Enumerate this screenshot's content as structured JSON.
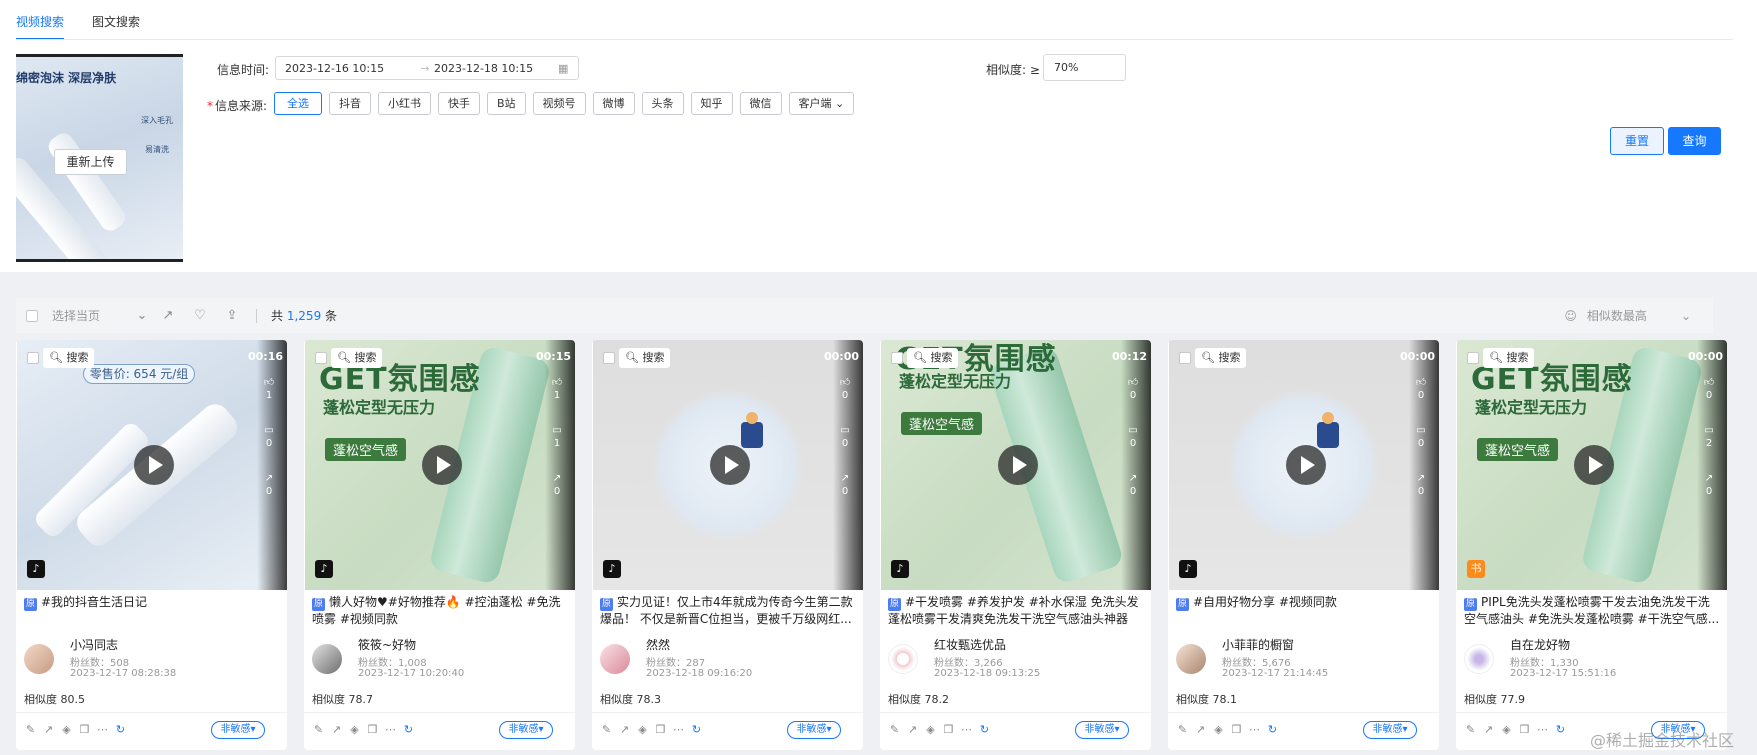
{
  "tabs": [
    {
      "label": "视频搜索",
      "active": true
    },
    {
      "label": "图文搜索",
      "active": false
    }
  ],
  "upload": {
    "preview_headline": "绵密泡沫 深层净肤",
    "side_badges": [
      "深入毛孔",
      "易清洗"
    ],
    "reupload_label": "重新上传"
  },
  "filters": {
    "time_label": "信息时间:",
    "start_date": "2023-12-16 10:15",
    "end_date": "2023-12-18 10:15",
    "similarity_label": "相似度: ≥",
    "similarity_value": "70%",
    "source_label": "信息来源:",
    "sources": [
      {
        "label": "全选",
        "active": true
      },
      {
        "label": "抖音",
        "active": false
      },
      {
        "label": "小红书",
        "active": false
      },
      {
        "label": "快手",
        "active": false
      },
      {
        "label": "B站",
        "active": false
      },
      {
        "label": "视频号",
        "active": false
      },
      {
        "label": "微博",
        "active": false
      },
      {
        "label": "头条",
        "active": false
      },
      {
        "label": "知乎",
        "active": false
      },
      {
        "label": "微信",
        "active": false
      },
      {
        "label": "客户端",
        "active": false
      }
    ],
    "reset_label": "重置",
    "query_label": "查询"
  },
  "toolbar": {
    "select_page": "选择当页",
    "count_prefix": "共",
    "count": "1,259",
    "count_suffix": "条",
    "sort_label": "相似数最高"
  },
  "cards": [
    {
      "search_label": "搜索",
      "duration": "00:16",
      "likes": "1",
      "comments": "0",
      "shares": "0",
      "price_text": "零售价: 654 元/组",
      "badge": "原",
      "title": "#我的抖音生活日记",
      "author": "小冯同志",
      "fans": "粉丝数：508",
      "time": "2023-12-17 08:28:38",
      "similarity": "相似度 80.5",
      "feel_label": "非敏感"
    },
    {
      "search_label": "搜索",
      "duration": "00:15",
      "likes": "1",
      "comments": "1",
      "shares": "0",
      "deco_title": "GET氛围感",
      "deco_sub": "蓬松定型无压力",
      "deco_pill": "蓬松空气感",
      "badge": "原",
      "title": "懒人好物♥#好物推荐🔥 #控油蓬松 #免洗喷雾 #视频同款",
      "author": "筱筱~好物",
      "fans": "粉丝数：1,008",
      "time": "2023-12-17 10:20:40",
      "similarity": "相似度 78.7",
      "feel_label": "非敏感"
    },
    {
      "search_label": "搜索",
      "duration": "00:00",
      "likes": "0",
      "comments": "0",
      "shares": "0",
      "badge": "原",
      "title": "实力见证！仅上市4年就成为传奇今生第二款爆品！ 不仅是新晋C位担当，更被千万级网红...",
      "author": "然然",
      "fans": "粉丝数：287",
      "time": "2023-12-18 09:16:20",
      "similarity": "相似度 78.3",
      "feel_label": "非敏感"
    },
    {
      "search_label": "搜索",
      "duration": "00:12",
      "likes": "0",
      "comments": "0",
      "shares": "0",
      "deco_title": "GET氛围感",
      "deco_sub": "蓬松定型无压力",
      "deco_pill": "蓬松空气感",
      "badge": "原",
      "title": "#干发喷雾 #养发护发 #补水保湿 免洗头发蓬松喷雾干发清爽免洗发干洗空气感油头神器蓬...",
      "author": "红妆甄选优品",
      "fans": "粉丝数：3,266",
      "time": "2023-12-18 09:13:25",
      "similarity": "相似度 78.2",
      "feel_label": "非敏感"
    },
    {
      "search_label": "搜索",
      "duration": "00:00",
      "likes": "0",
      "comments": "0",
      "shares": "0",
      "badge": "原",
      "title": "#自用好物分享 #视频同款",
      "author": "小菲菲的橱窗",
      "fans": "粉丝数：5,676",
      "time": "2023-12-17 21:14:45",
      "similarity": "相似度 78.1",
      "feel_label": "非敏感"
    },
    {
      "search_label": "搜索",
      "duration": "00:00",
      "likes": "0",
      "comments": "2",
      "shares": "0",
      "deco_title": "GET氛围感",
      "deco_sub": "蓬松定型无压力",
      "deco_pill": "蓬松空气感",
      "badge": "原",
      "title": "PIPL免洗头发蓬松喷雾干发去油免洗发干洗空气感油头 #免洗头发蓬松喷雾 #干洗空气感...",
      "author": "自在龙好物",
      "fans": "粉丝数：1,330",
      "time": "2023-12-17 15:51:16",
      "similarity": "相似度 77.9",
      "feel_label": "非敏感"
    }
  ],
  "watermark": "@稀土掘金技术社区",
  "colors": {
    "accent": "#1677ff",
    "required": "#f5222d"
  }
}
